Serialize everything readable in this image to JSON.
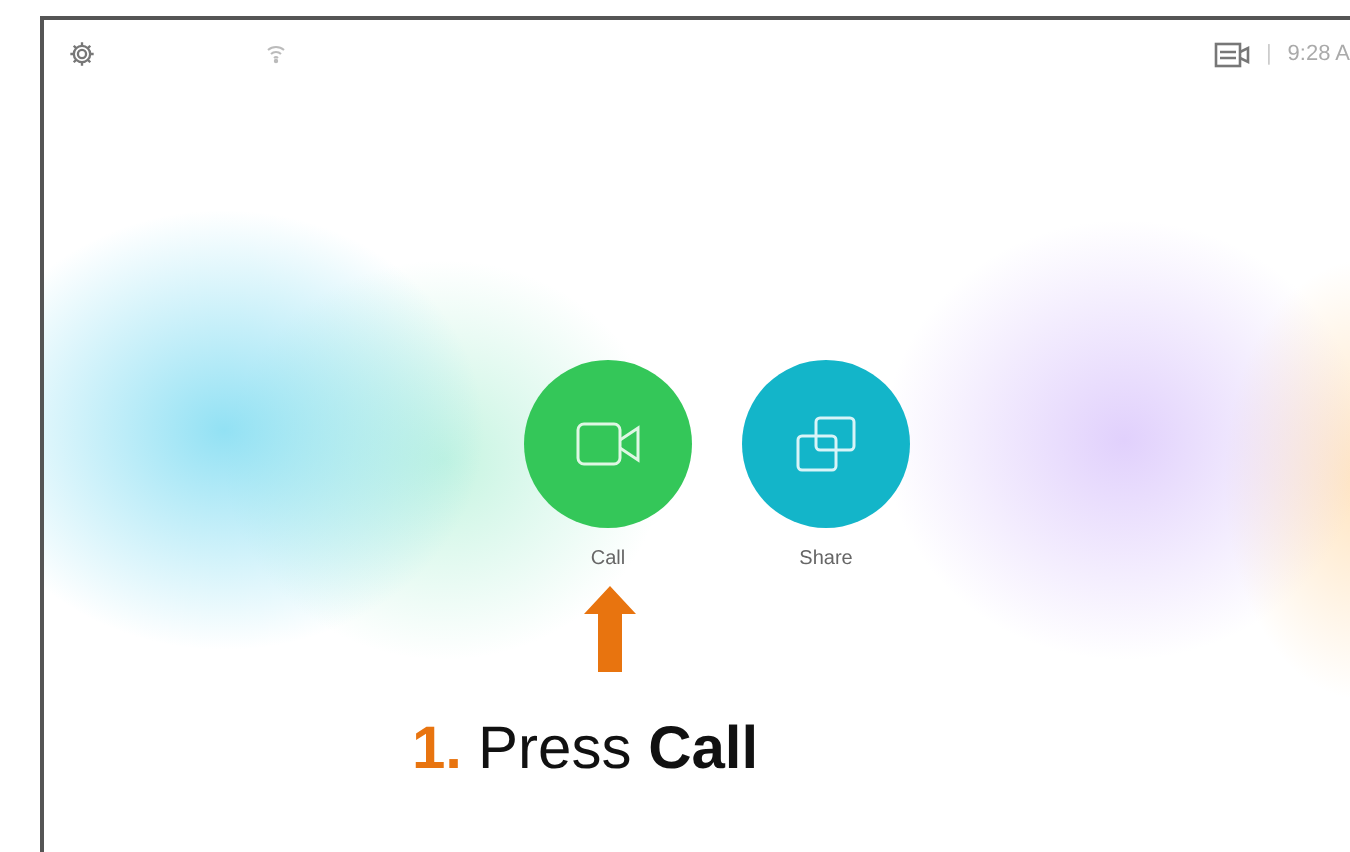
{
  "status_bar": {
    "separator": "|",
    "time": "9:28 A"
  },
  "actions": [
    {
      "kind": "call",
      "label": "Call"
    },
    {
      "kind": "share",
      "label": "Share"
    }
  ],
  "annotation": {
    "step": "1.",
    "text": "Press **Call**"
  }
}
